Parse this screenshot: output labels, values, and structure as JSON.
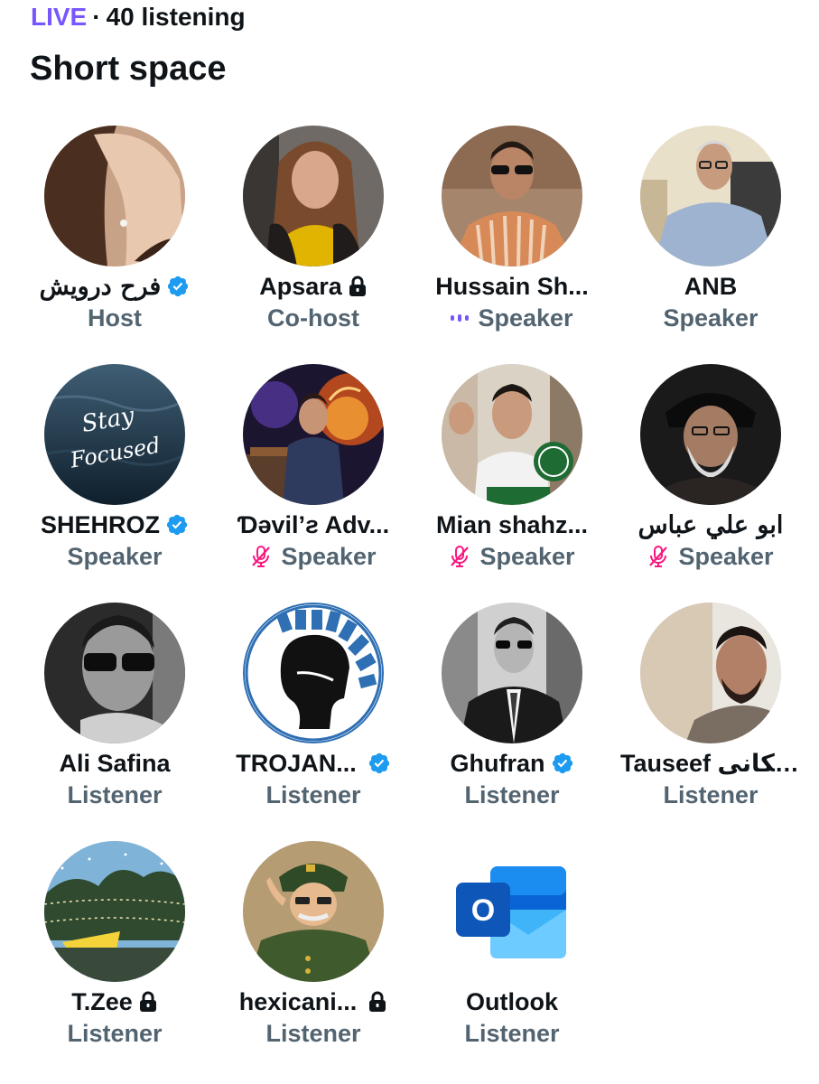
{
  "header": {
    "live_label": "LIVE",
    "separator": "·",
    "listening": "40 listening"
  },
  "space": {
    "title": "Short space"
  },
  "colors": {
    "live": "#7856ff",
    "verified": "#1d9bf0",
    "role_text": "#536471",
    "muted_icon": "#f4212e",
    "speaking_icon": "#7856ff"
  },
  "participants": [
    {
      "name": "فرح درویش",
      "role": "Host",
      "badge": "verified-icon",
      "status": ""
    },
    {
      "name": "Apsara",
      "role": "Co-host",
      "badge": "lock-icon",
      "status": ""
    },
    {
      "name": "Hussain Sh...",
      "role": "Speaker",
      "badge": "",
      "status": "speaking-icon"
    },
    {
      "name": "ANB",
      "role": "Speaker",
      "badge": "",
      "status": ""
    },
    {
      "name": "SHEHROZ",
      "role": "Speaker",
      "badge": "verified-icon",
      "status": ""
    },
    {
      "name": "Ɗəvil’ƨ Adv...",
      "role": "Speaker",
      "badge": "",
      "status": "muted-mic-icon"
    },
    {
      "name": "Mian shahz...",
      "role": "Speaker",
      "badge": "",
      "status": "muted-mic-icon"
    },
    {
      "name": "ابو علي عباس",
      "role": "Speaker",
      "badge": "",
      "status": "muted-mic-icon"
    },
    {
      "name": "Ali Safina",
      "role": "Listener",
      "badge": "",
      "status": ""
    },
    {
      "name": "TROJAN...",
      "role": "Listener",
      "badge": "verified-icon",
      "status": ""
    },
    {
      "name": "Ghufran",
      "role": "Listener",
      "badge": "verified-icon",
      "status": ""
    },
    {
      "name": "Tauseef جسکانی",
      "role": "Listener",
      "badge": "",
      "status": ""
    },
    {
      "name": "T.Zee",
      "role": "Listener",
      "badge": "lock-icon",
      "status": ""
    },
    {
      "name": "hexicani...",
      "role": "Listener",
      "badge": "lock-icon",
      "status": ""
    },
    {
      "name": "Outlook",
      "role": "Listener",
      "badge": "",
      "status": ""
    }
  ],
  "avatar_art": {
    "stay_focused_line1": "Stay",
    "stay_focused_line2": "Focused",
    "outlook_letter": "O"
  }
}
